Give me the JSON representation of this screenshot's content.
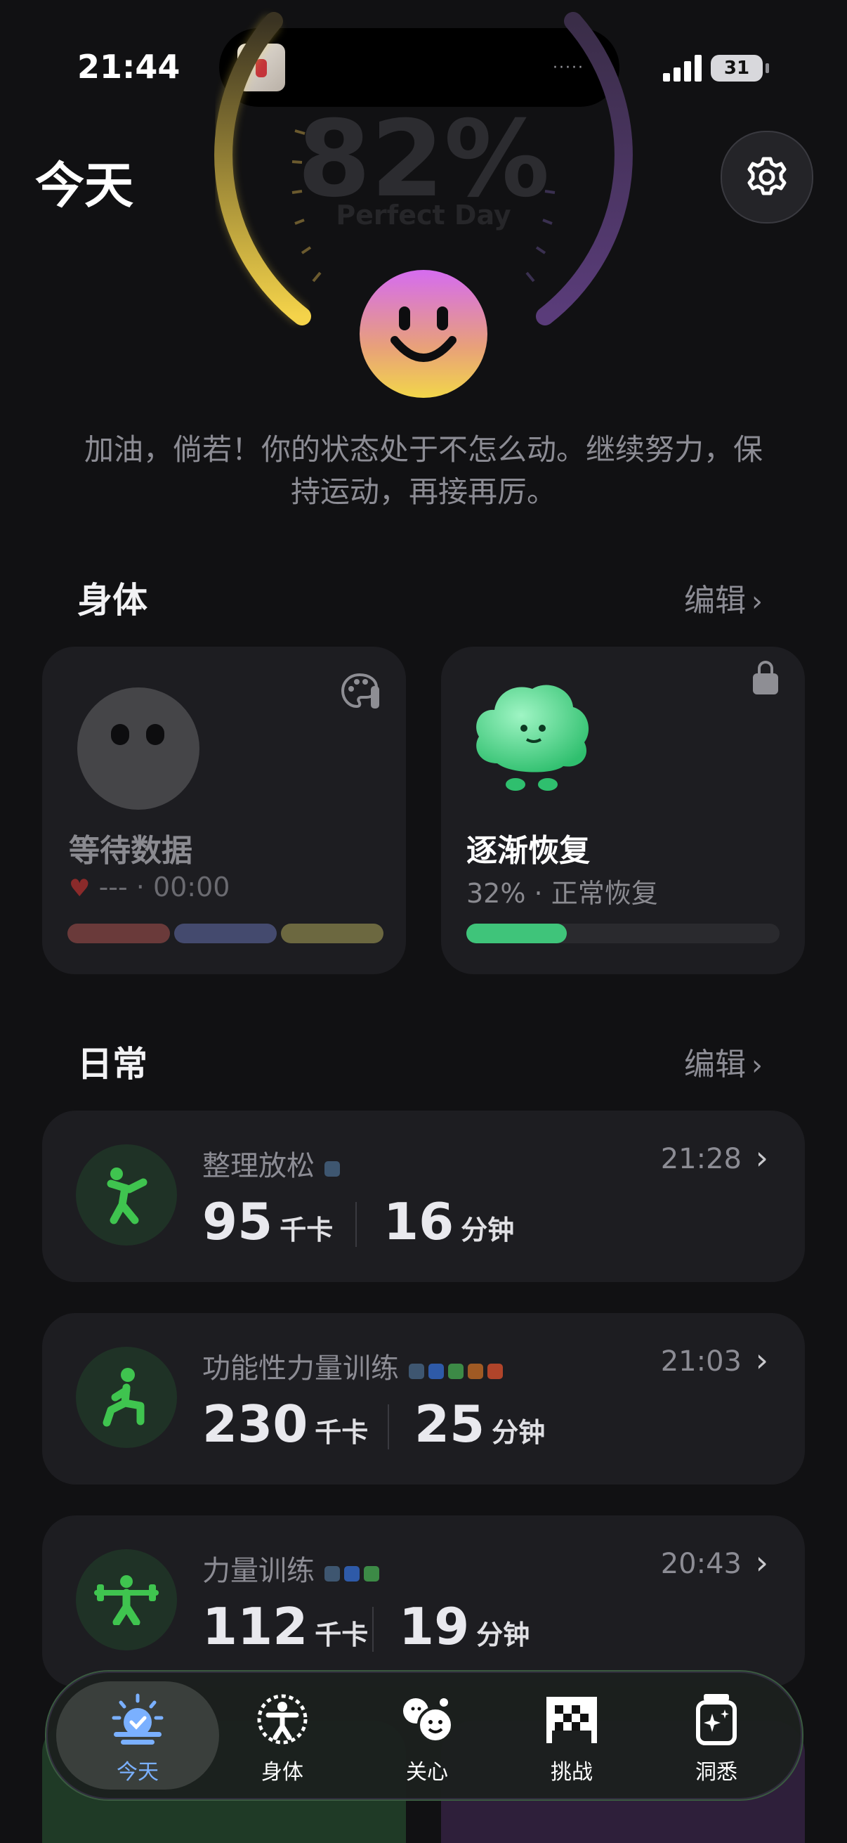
{
  "status_bar": {
    "time": "21:44",
    "island_dots": "·····",
    "battery": "31"
  },
  "header": {
    "title": "今天"
  },
  "gauge": {
    "percent": "82%",
    "label": "Perfect Day",
    "level": 0.82
  },
  "motto": "加油，倘若！你的状态处于不怎么动。继续努力，保持运动，再接再厉。",
  "body_section": {
    "title": "身体",
    "edit_label": "编辑",
    "cards": [
      {
        "title": "等待数据",
        "detail": "--- · 00:00",
        "bar_colors": [
          "#6a3a3a",
          "#444a6e",
          "#6c6840"
        ]
      },
      {
        "title": "逐渐恢复",
        "detail": "32% · 正常恢复",
        "progress": 0.32,
        "accent": "#3fc47a"
      }
    ]
  },
  "daily_section": {
    "title": "日常",
    "edit_label": "编辑",
    "activities": [
      {
        "name": "整理放松",
        "time": "21:28",
        "kcal": "95",
        "kcal_unit": "千卡",
        "minutes": "16",
        "min_unit": "分钟",
        "dots": [
          "#3e5670"
        ]
      },
      {
        "name": "功能性力量训练",
        "time": "21:03",
        "kcal": "230",
        "kcal_unit": "千卡",
        "minutes": "25",
        "min_unit": "分钟",
        "dots": [
          "#3e5670",
          "#2e5aa8",
          "#3c8a46",
          "#a05a24",
          "#b0442a"
        ]
      },
      {
        "name": "力量训练",
        "time": "20:43",
        "kcal": "112",
        "kcal_unit": "千卡",
        "minutes": "19",
        "min_unit": "分钟",
        "dots": [
          "#3e5670",
          "#2e5aa8",
          "#3c8a46"
        ]
      }
    ]
  },
  "tabs": [
    {
      "label": "今天",
      "icon": "sun-check-icon",
      "active": true
    },
    {
      "label": "身体",
      "icon": "body-icon"
    },
    {
      "label": "关心",
      "icon": "care-faces-icon"
    },
    {
      "label": "挑战",
      "icon": "checkered-flag-icon"
    },
    {
      "label": "洞悉",
      "icon": "sparkle-jar-icon"
    }
  ],
  "colors": {
    "accent": "#7ab0ff",
    "recovery": "#3fc47a",
    "activity_icon": "#3fc44f"
  }
}
